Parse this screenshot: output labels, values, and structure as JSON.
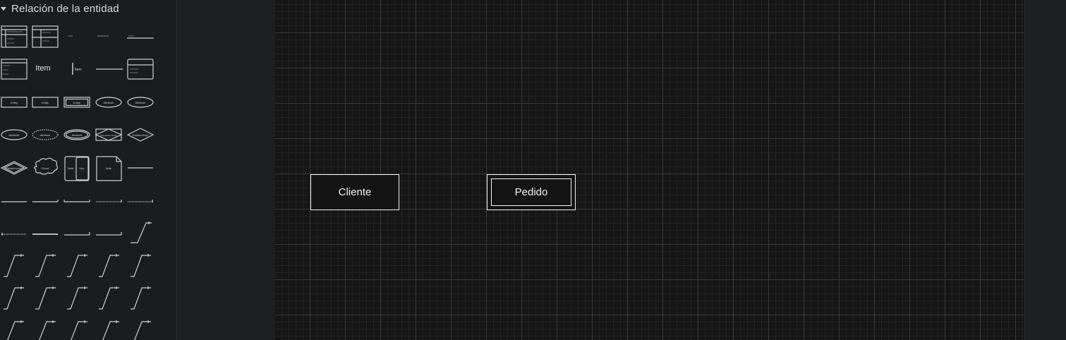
{
  "sidebar": {
    "section_title": "Relación de la entidad",
    "shape_texts": {
      "item": "Item",
      "entity": "Entity",
      "attribute": "Attribute",
      "relationship": "Relationship",
      "cloud": "Cloud",
      "note": "Note",
      "table": "Table",
      "key": "Key",
      "ident_rel": "Associative Entity"
    }
  },
  "canvas": {
    "entities": [
      {
        "name": "Cliente",
        "style": "single"
      },
      {
        "name": "Pedido",
        "style": "double"
      }
    ]
  },
  "colors": {
    "canvas_bg": "#161616",
    "panel_bg": "#1e1f22",
    "stroke": "#f2f2f2"
  }
}
